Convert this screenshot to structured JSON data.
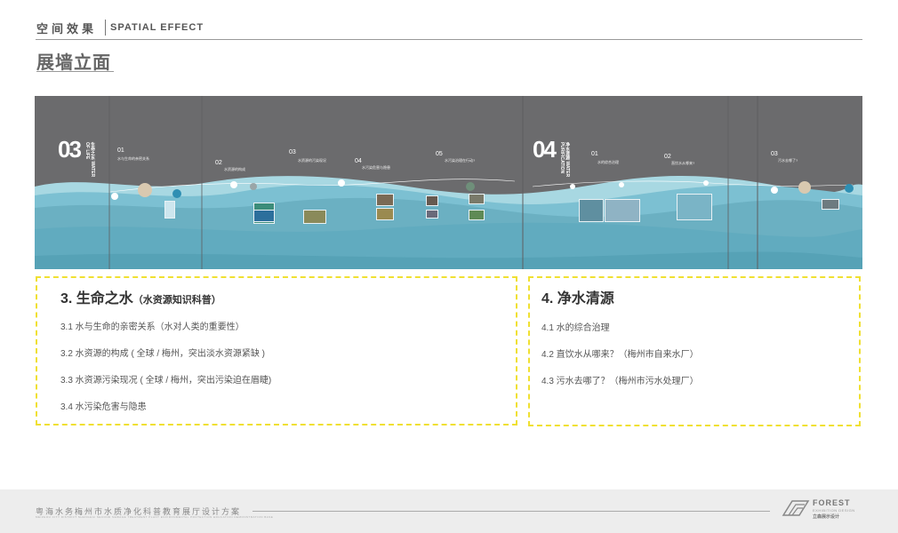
{
  "header": {
    "title_cn": "空间效果",
    "title_en": "SPATIAL EFFECT"
  },
  "section": {
    "title": "展墙立面"
  },
  "wall": {
    "colors": {
      "top": "#6b6b6d",
      "wave_light": "#a8d8e2",
      "wave_mid": "#7cc0d2",
      "wave_dark": "#5aa9bd",
      "base": "#6bb0c2"
    },
    "part3": {
      "big_number": "03",
      "vertical_title": "生命之水 WATER OF LIFE",
      "labels": [
        {
          "num": "01",
          "text": "水与生命的亲密关系"
        },
        {
          "num": "02",
          "text": "水资源的构成"
        },
        {
          "num": "03",
          "text": "水资源的污染现况"
        },
        {
          "num": "04",
          "text": "水污染危害与隐患"
        },
        {
          "num": "05",
          "text": "水污染治理在行动?"
        }
      ]
    },
    "part4": {
      "big_number": "04",
      "vertical_title": "净水清源 WATER PURIFICATION",
      "labels": [
        {
          "num": "01",
          "text": "水的综合治理"
        },
        {
          "num": "02",
          "text": "直饮水从哪来?"
        },
        {
          "num": "03",
          "text": "污水去哪了?"
        }
      ]
    }
  },
  "left_box": {
    "title": "3. 生命之水",
    "subtitle": "（水资源知识科普）",
    "items": [
      "3.1 水与生命的亲密关系（水对人类的重要性）",
      "3.2 水资源的构成 ( 全球 / 梅州，突出淡水资源紧缺 )",
      "3.3 水资源污染现况 ( 全球 / 梅州，突出污染迫在眉睫)",
      "3.4 水污染危害与隐患"
    ]
  },
  "right_box": {
    "title": "4. 净水清源",
    "items": [
      "4.1 水的综合治理",
      "4.2 直饮水从哪来？（梅州市自来水厂）",
      "4.3 污水去哪了？（梅州市污水处理厂）"
    ]
  },
  "footer": {
    "title": "粤海水务梅州市水质净化科普教育展厅设计方案",
    "subtitle": "MEIZHOU CITY DISTRICT SHANGHAI SECOND SEWAGE TREATMENT PLANT ENVIRONMENTAL PROTECTION EDUCATION DEMONSTRATION BASE",
    "logo_word": "FOREST",
    "logo_sub": "EXHIBITION DESIGN",
    "logo_cn": "立森展示设计"
  }
}
